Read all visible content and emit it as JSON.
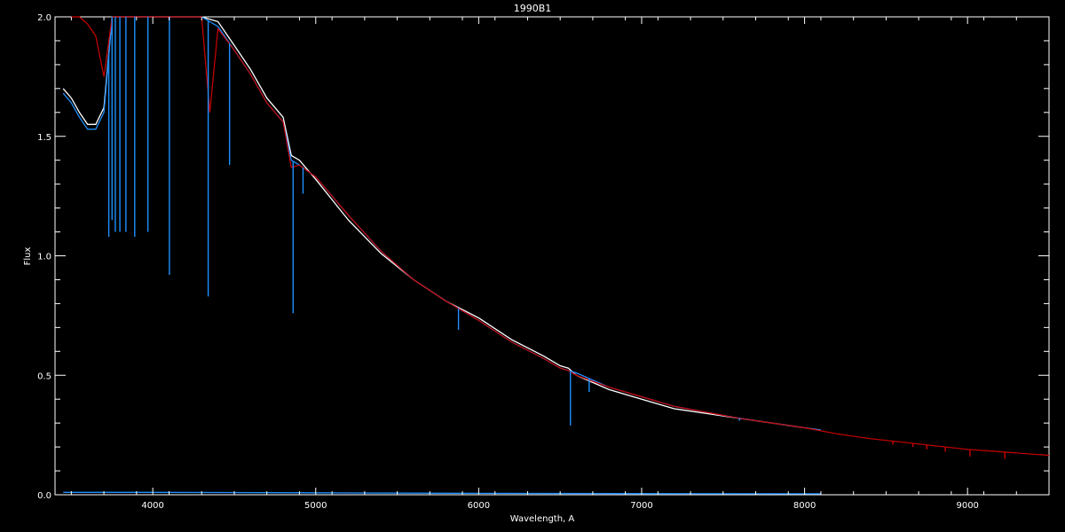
{
  "chart_data": {
    "type": "line",
    "title": "1990B1",
    "xlabel": "Wavelength, A",
    "ylabel": "Flux",
    "xlim": [
      3400,
      9500
    ],
    "ylim": [
      0.0,
      2.0
    ],
    "xticks": [
      4000,
      5000,
      6000,
      7000,
      8000,
      9000
    ],
    "yticks": [
      0.0,
      0.5,
      1.0,
      1.5,
      2.0
    ],
    "ytick_labels": [
      "0.0",
      "0.5",
      "1.0",
      "1.5",
      "2.0"
    ],
    "grid": false,
    "colors": {
      "background": "#000000",
      "axes": "#ffffff",
      "observed": "#ffffff",
      "fit": "#1e90ff",
      "model": "#cc0000",
      "error": "#1e90ff"
    },
    "series": [
      {
        "key": "observed",
        "x": [
          3450,
          3500,
          3550,
          3600,
          3650,
          3700,
          3750,
          3800,
          3900,
          4000,
          4100,
          4200,
          4300,
          4400,
          4500,
          4600,
          4700,
          4800,
          4850,
          4900,
          5000,
          5200,
          5400,
          5600,
          5800,
          6000,
          6200,
          6400,
          6500,
          6550,
          6600,
          6800,
          7000,
          7200,
          7400,
          7600,
          7800,
          8000,
          8100
        ],
        "y": [
          1.7,
          1.66,
          1.6,
          1.55,
          1.55,
          1.62,
          2.0,
          2.0,
          2.0,
          2.0,
          2.0,
          2.0,
          2.0,
          1.98,
          1.88,
          1.78,
          1.66,
          1.58,
          1.42,
          1.4,
          1.32,
          1.15,
          1.01,
          0.9,
          0.81,
          0.74,
          0.65,
          0.58,
          0.54,
          0.53,
          0.5,
          0.44,
          0.4,
          0.36,
          0.34,
          0.32,
          0.3,
          0.28,
          0.27
        ]
      },
      {
        "key": "fit",
        "x": [
          3450,
          3500,
          3550,
          3600,
          3650,
          3700,
          3750,
          3800,
          3900,
          4000,
          4100,
          4200,
          4300,
          4400,
          4500,
          4600,
          4700,
          4800,
          4850,
          4900,
          5000,
          5200,
          5400,
          5600,
          5800,
          6000,
          6200,
          6400,
          6500,
          6550,
          6600,
          6800,
          7000,
          7200,
          7400,
          7600,
          7800,
          8000,
          8100
        ],
        "y": [
          1.68,
          1.64,
          1.58,
          1.53,
          1.53,
          1.6,
          2.0,
          2.0,
          2.0,
          2.0,
          2.0,
          2.0,
          2.0,
          1.96,
          1.86,
          1.76,
          1.64,
          1.56,
          1.4,
          1.38,
          1.33,
          1.17,
          1.02,
          0.9,
          0.81,
          0.73,
          0.64,
          0.57,
          0.53,
          0.52,
          0.51,
          0.45,
          0.41,
          0.37,
          0.345,
          0.32,
          0.3,
          0.28,
          0.27
        ]
      },
      {
        "key": "model",
        "x": [
          3500,
          3550,
          3600,
          3650,
          3700,
          3750,
          3800,
          3900,
          4000,
          4100,
          4200,
          4300,
          4350,
          4400,
          4500,
          4600,
          4700,
          4800,
          4850,
          4900,
          5000,
          5200,
          5400,
          5600,
          5800,
          6000,
          6200,
          6400,
          6500,
          6550,
          6600,
          6800,
          7000,
          7200,
          7400,
          7600,
          7800,
          8000,
          8200,
          8400,
          8600,
          8800,
          9000,
          9200,
          9400,
          9500
        ],
        "y": [
          2.0,
          2.0,
          1.97,
          1.92,
          1.75,
          2.0,
          2.0,
          2.0,
          2.0,
          2.0,
          2.0,
          2.0,
          1.6,
          1.95,
          1.86,
          1.76,
          1.64,
          1.56,
          1.37,
          1.38,
          1.33,
          1.17,
          1.02,
          0.9,
          0.81,
          0.73,
          0.64,
          0.57,
          0.53,
          0.52,
          0.5,
          0.45,
          0.41,
          0.37,
          0.345,
          0.32,
          0.3,
          0.28,
          0.255,
          0.235,
          0.22,
          0.205,
          0.19,
          0.18,
          0.17,
          0.165
        ]
      },
      {
        "key": "error",
        "x": [
          3450,
          4000,
          5000,
          6000,
          7000,
          8000,
          8100
        ],
        "y": [
          0.01,
          0.01,
          0.008,
          0.006,
          0.005,
          0.004,
          0.004
        ]
      }
    ],
    "absorption_lines": [
      {
        "series": "fit",
        "x": 3730,
        "depth": 1.08
      },
      {
        "series": "fit",
        "x": 3750,
        "depth": 1.15
      },
      {
        "series": "fit",
        "x": 3770,
        "depth": 1.1
      },
      {
        "series": "fit",
        "x": 3798,
        "depth": 1.1
      },
      {
        "series": "fit",
        "x": 3835,
        "depth": 1.1
      },
      {
        "series": "fit",
        "x": 3889,
        "depth": 1.08
      },
      {
        "series": "fit",
        "x": 3970,
        "depth": 1.1
      },
      {
        "series": "fit",
        "x": 4102,
        "depth": 0.92
      },
      {
        "series": "fit",
        "x": 4340,
        "depth": 0.83
      },
      {
        "series": "fit",
        "x": 4471,
        "depth": 1.38
      },
      {
        "series": "fit",
        "x": 4861,
        "depth": 0.76
      },
      {
        "series": "fit",
        "x": 4922,
        "depth": 1.26
      },
      {
        "series": "fit",
        "x": 5876,
        "depth": 0.69
      },
      {
        "series": "fit",
        "x": 6563,
        "depth": 0.29
      },
      {
        "series": "fit",
        "x": 6678,
        "depth": 0.43
      },
      {
        "series": "fit",
        "x": 7600,
        "depth": 0.31
      },
      {
        "series": "model",
        "x": 8542,
        "depth": 0.21
      },
      {
        "series": "model",
        "x": 8665,
        "depth": 0.2
      },
      {
        "series": "model",
        "x": 8750,
        "depth": 0.19
      },
      {
        "series": "model",
        "x": 8863,
        "depth": 0.18
      },
      {
        "series": "model",
        "x": 9015,
        "depth": 0.16
      },
      {
        "series": "model",
        "x": 9229,
        "depth": 0.15
      }
    ]
  }
}
